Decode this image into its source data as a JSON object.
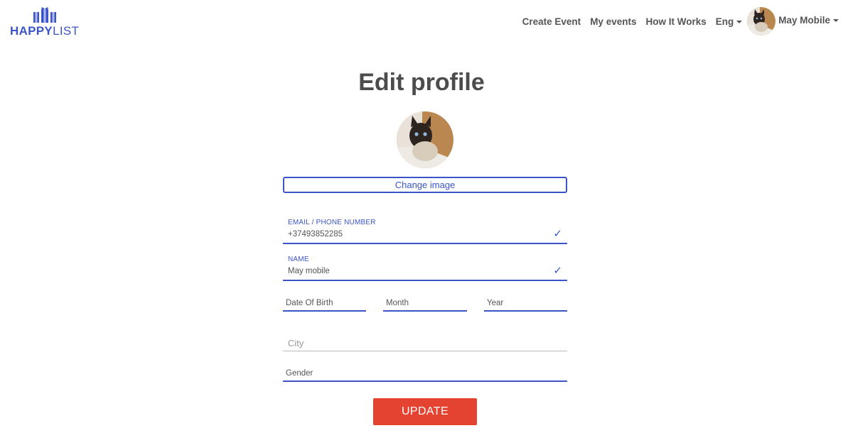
{
  "brand": {
    "name_bold": "HAPPY",
    "name_light": "LIST",
    "accent": "#3b55c9"
  },
  "nav": {
    "create_event": "Create Event",
    "my_events": "My events",
    "how_it_works": "How It Works",
    "language": "Eng",
    "user_name": "May Mobile"
  },
  "page": {
    "title": "Edit profile"
  },
  "profile": {
    "change_image_label": "Change image",
    "email_label": "EMAIL / PHONE NUMBER",
    "email_value": "+37493852285",
    "name_label": "NAME",
    "name_value": "May mobile",
    "check_icon": "✓",
    "dob_day_label": "Date Of Birth",
    "dob_month_label": "Month",
    "dob_year_label": "Year",
    "city_placeholder": "City",
    "gender_label": "Gender",
    "update_label": "UPDATE",
    "update_color": "#e44332"
  }
}
